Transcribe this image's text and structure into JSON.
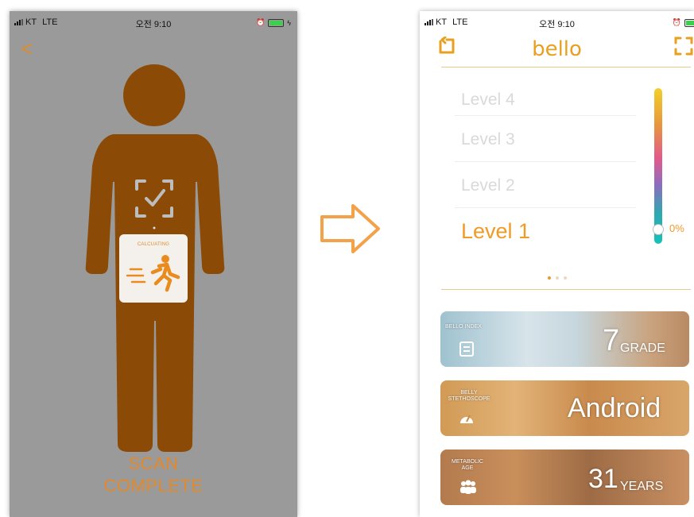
{
  "left_screen": {
    "status": {
      "carrier": "KT",
      "network": "LTE",
      "time": "오전 9:10"
    },
    "back_glyph": "<",
    "calculating_label": "CALCUATING",
    "scan_line1": "SCAN",
    "scan_line2": "COMPLETE"
  },
  "right_screen": {
    "status": {
      "carrier": "KT",
      "network": "LTE",
      "time": "오전 9:10"
    },
    "brand": "bello",
    "levels": [
      {
        "label": "Level 4"
      },
      {
        "label": "Level 3"
      },
      {
        "label": "Level 2"
      },
      {
        "label": "Level 1"
      }
    ],
    "active_level": "Level 1",
    "gauge_percent_text": "0%",
    "gauge_level": 0,
    "cards": [
      {
        "small_label": "BELLO INDEX",
        "big_value": "7",
        "unit": "GRADE",
        "icon": "clipboard-icon"
      },
      {
        "small_label": "BELLY STETHOSCOPE",
        "big_value": "Android",
        "unit": "",
        "icon": "gauge-icon"
      },
      {
        "small_label": "METABOLIC AGE",
        "big_value": "31",
        "unit": "YEARS",
        "icon": "people-icon"
      }
    ]
  },
  "colors": {
    "accent": "#f09b27",
    "figure": "#8b4a05",
    "left_bg": "#9a9a9a"
  }
}
